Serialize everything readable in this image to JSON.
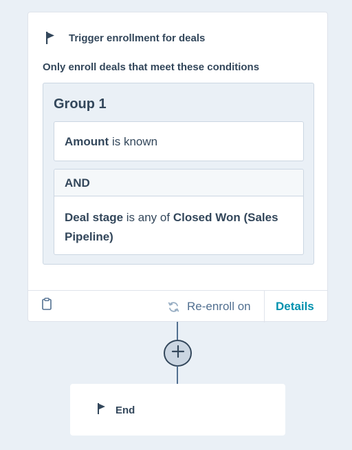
{
  "trigger": {
    "title": "Trigger enrollment for deals",
    "icon": "flag-icon",
    "conditions_label": "Only enroll deals that meet these conditions",
    "group": {
      "title": "Group 1",
      "conditions": [
        {
          "property": "Amount",
          "operator": " is known"
        },
        {
          "joiner": "AND",
          "property": "Deal stage",
          "operator": " is any of ",
          "value": "Closed Won (Sales Pipeline)"
        }
      ]
    },
    "footer": {
      "clipboard_icon": "clipboard-icon",
      "refresh_icon": "refresh-icon",
      "reenroll_label": "Re-enroll on",
      "details_label": "Details"
    }
  },
  "add_action": {
    "icon": "plus-icon"
  },
  "end": {
    "label": "End",
    "icon": "flag-icon"
  },
  "colors": {
    "background": "#eaf0f6",
    "text": "#33475b",
    "link": "#0091ae",
    "border": "#cbd6e2"
  }
}
